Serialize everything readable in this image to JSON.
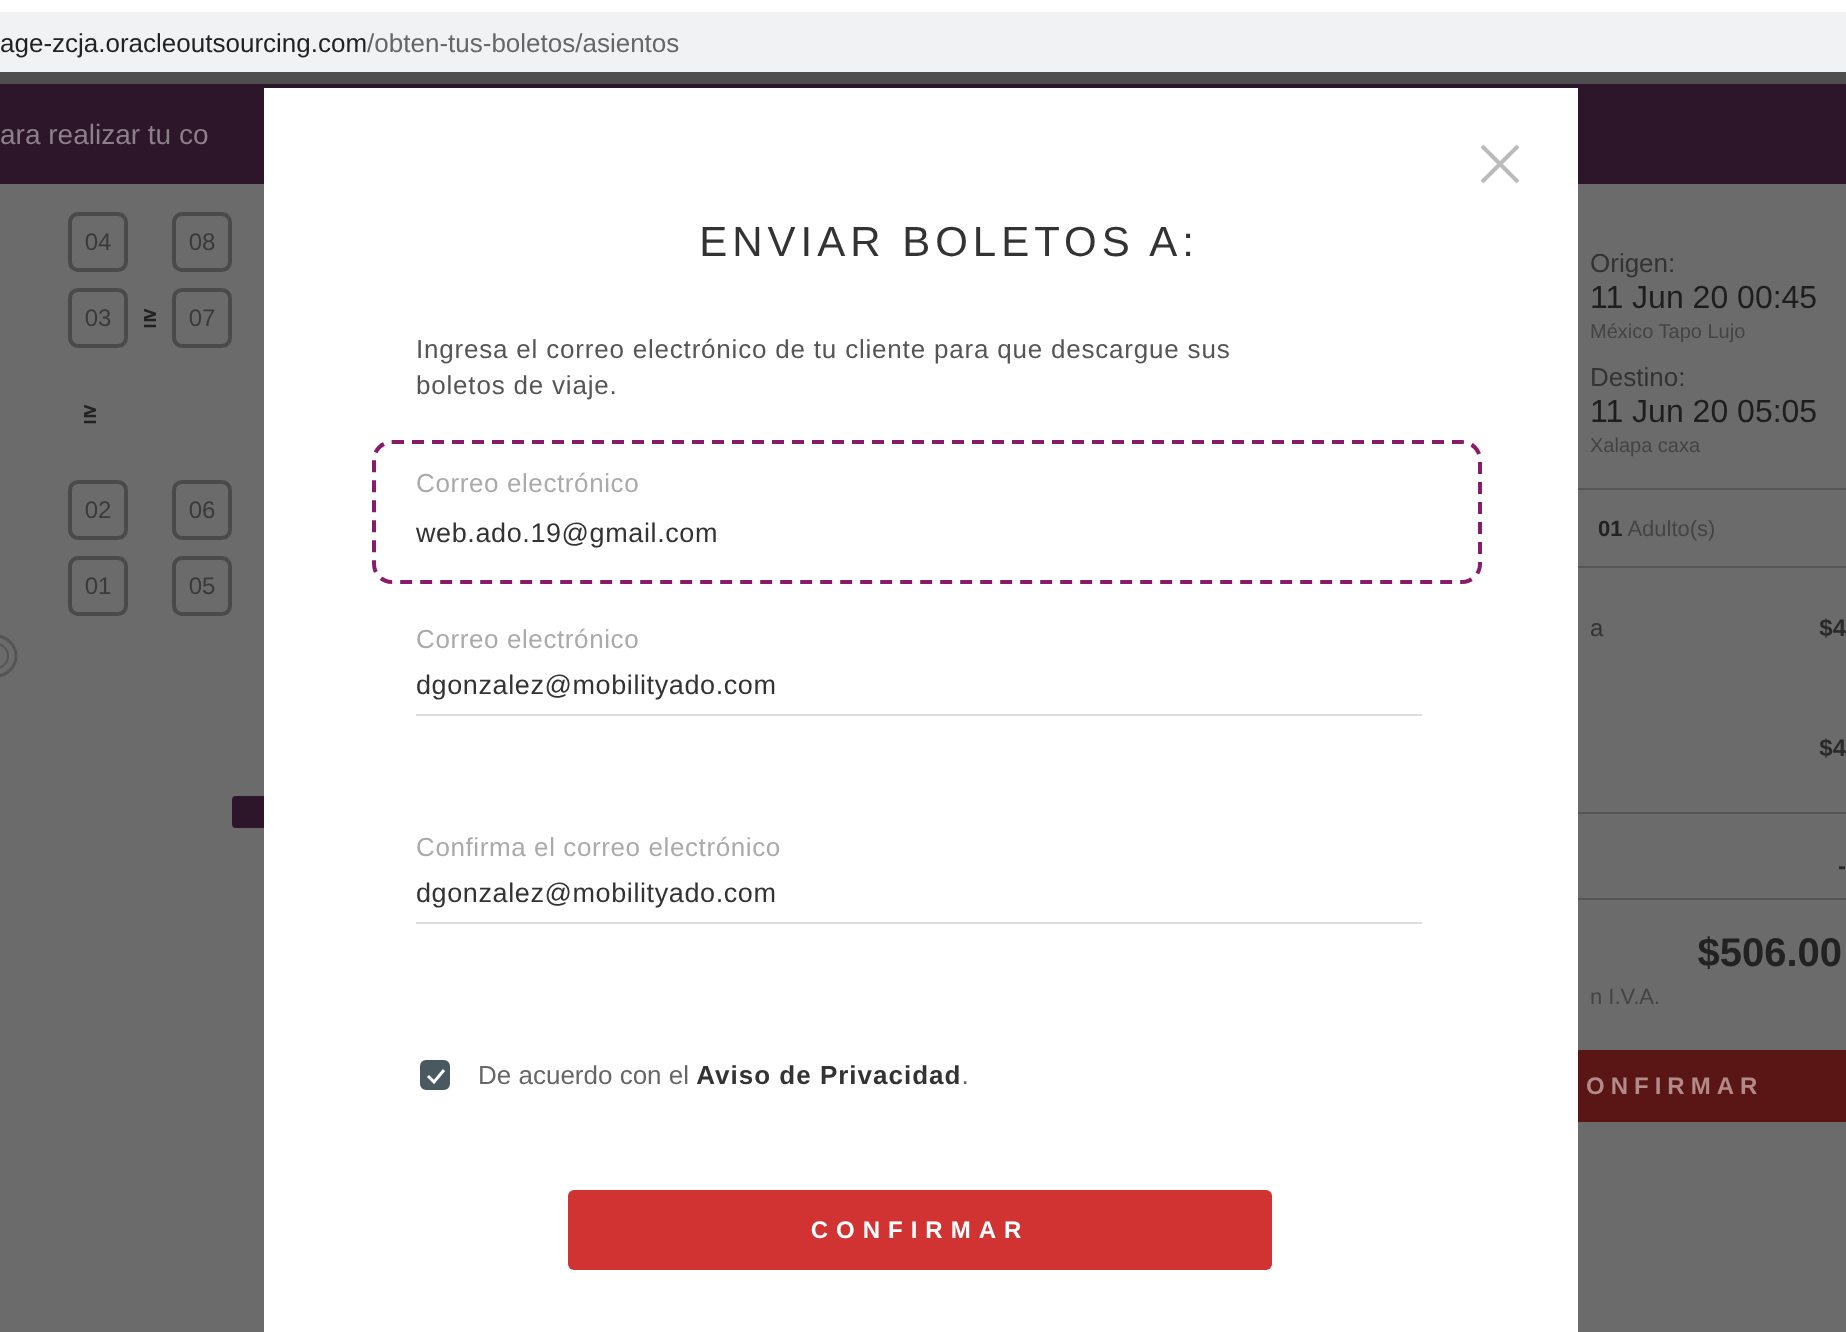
{
  "address_bar": {
    "host": "age-zcja.oracleoutsourcing.com",
    "path": "/obten-tus-boletos/asientos"
  },
  "banner": {
    "text": "ara realizar tu co"
  },
  "seat_map": {
    "rows": [
      [
        "04",
        "08"
      ],
      [
        "03",
        "07"
      ],
      [],
      [
        "02",
        "06"
      ],
      [
        "01",
        "05"
      ]
    ]
  },
  "summary": {
    "origin_label": "Origen:",
    "origin_time": "11 Jun 20 00:45",
    "origin_place": "México Tapo Lujo",
    "destination_label": "Destino:",
    "destination_time": "11 Jun 20 05:05",
    "destination_place": "Xalapa caxa",
    "passengers": "**01** Adulto(s)",
    "line_1_label": "a",
    "line_1_amount": "$4",
    "line_2_amount": "$4",
    "line_3_amount": "-",
    "total": "$506.00",
    "tax_note": "n I.V.A.",
    "confirm_button": "ONFIRMAR"
  },
  "modal": {
    "title": "ENVIAR BOLETOS A:",
    "description": "Ingresa el correo electrónico de tu cliente para que descargue sus boletos de viaje.",
    "fields": [
      {
        "label": "Correo electrónico",
        "value": "web.ado.19@gmail.com",
        "highlighted": true
      },
      {
        "label": "Correo electrónico",
        "value": "dgonzalez@mobilityado.com",
        "highlighted": false
      },
      {
        "label": "Confirma el correo electrónico",
        "value": "dgonzalez@mobilityado.com",
        "highlighted": false
      }
    ],
    "consent": {
      "text": "De acuerdo con el **Aviso de Privacidad**.",
      "checked": true
    },
    "confirm_button": "CONFIRMAR"
  }
}
